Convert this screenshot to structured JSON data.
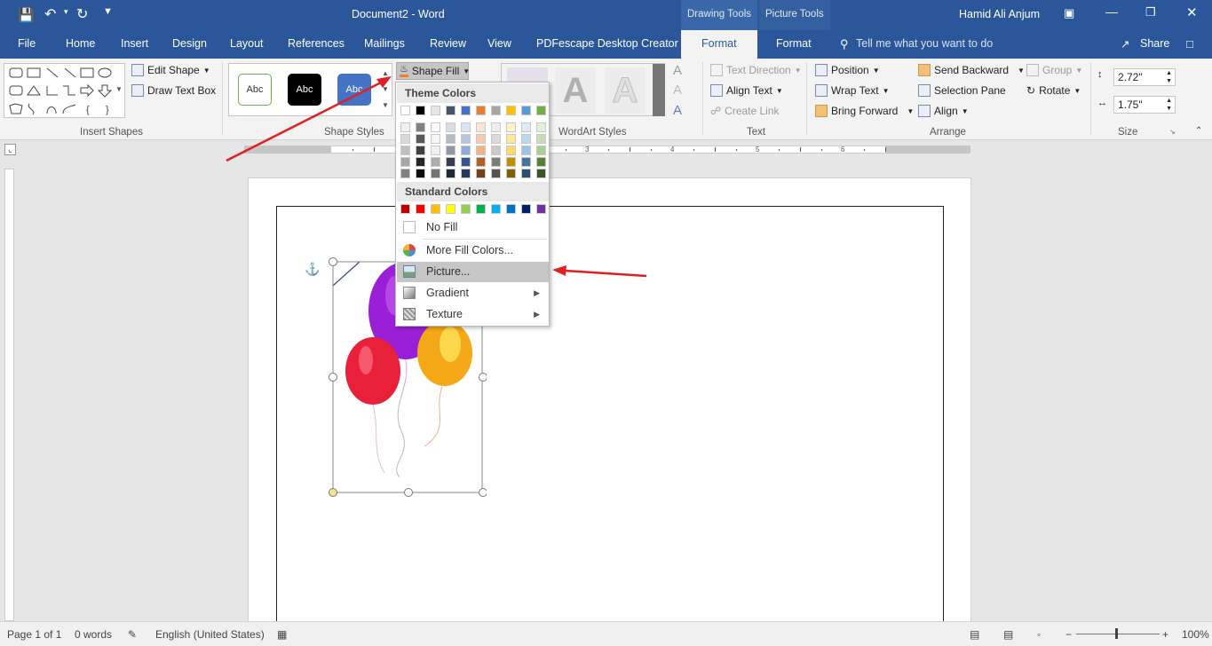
{
  "titlebar": {
    "title": "Document2  -  Word",
    "user": "Hamid Ali Anjum",
    "ctx_drawing": "Drawing Tools",
    "ctx_picture": "Picture Tools"
  },
  "tabs": [
    "File",
    "Home",
    "Insert",
    "Design",
    "Layout",
    "References",
    "Mailings",
    "Review",
    "View",
    "PDFescape Desktop Creator",
    "Format",
    "Format"
  ],
  "tellme": "Tell me what you want to do",
  "share": "Share",
  "ribbon": {
    "edit_shape": "Edit Shape",
    "draw_text_box": "Draw Text Box",
    "insert_shapes": "Insert Shapes",
    "style_sample": "Abc",
    "shape_fill": "Shape Fill",
    "shape_styles": "Shape Styles",
    "wordart_styles": "WordArt Styles",
    "text_direction": "Text Direction",
    "align_text": "Align Text",
    "create_link": "Create Link",
    "text_group": "Text",
    "position": "Position",
    "wrap_text": "Wrap Text",
    "bring_forward": "Bring Forward",
    "send_backward": "Send Backward",
    "selection_pane": "Selection Pane",
    "align": "Align",
    "group": "Group",
    "rotate": "Rotate",
    "arrange": "Arrange",
    "height": "2.72\"",
    "width": "1.75\"",
    "size": "Size"
  },
  "menu": {
    "theme_colors": "Theme Colors",
    "standard_colors": "Standard Colors",
    "no_fill": "No Fill",
    "more_fill": "More Fill Colors...",
    "picture": "Picture...",
    "gradient": "Gradient",
    "texture": "Texture",
    "theme_row": [
      "#ffffff",
      "#000000",
      "#e7e6e6",
      "#44546a",
      "#4472c4",
      "#ed7d31",
      "#a5a5a5",
      "#ffc000",
      "#5b9bd5",
      "#70ad47"
    ],
    "standard_row": [
      "#c00000",
      "#ff0000",
      "#ffc000",
      "#ffff00",
      "#92d050",
      "#00b050",
      "#00b0f0",
      "#0070c0",
      "#002060",
      "#7030a0"
    ]
  },
  "status": {
    "page": "Page 1 of 1",
    "words": "0 words",
    "language": "English (United States)",
    "zoom": "100%"
  },
  "colors": {
    "brand": "#2b579a",
    "arrow": "#e02020"
  }
}
